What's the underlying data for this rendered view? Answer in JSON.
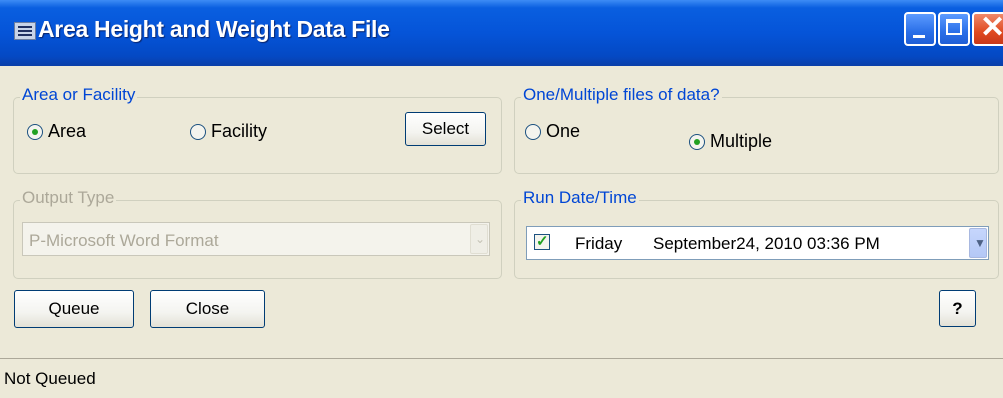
{
  "window": {
    "title": "Area Height and Weight Data File"
  },
  "area_group": {
    "legend": "Area or Facility",
    "options": [
      {
        "label": "Area",
        "checked": true
      },
      {
        "label": "Facility",
        "checked": false
      }
    ],
    "select_label": "Select"
  },
  "files_group": {
    "legend": "One/Multiple files of data?",
    "options": [
      {
        "label": "One",
        "checked": false
      },
      {
        "label": "Multiple",
        "checked": true
      }
    ]
  },
  "output_group": {
    "legend": "Output Type",
    "selected": "P-Microsoft Word Format",
    "enabled": false
  },
  "run_group": {
    "legend": "Run Date/Time",
    "checked": true,
    "day": "Friday",
    "datetime": "September24, 2010  03:36 PM"
  },
  "buttons": {
    "queue": "Queue",
    "close": "Close",
    "help": "?"
  },
  "status": {
    "text": "Not Queued"
  }
}
